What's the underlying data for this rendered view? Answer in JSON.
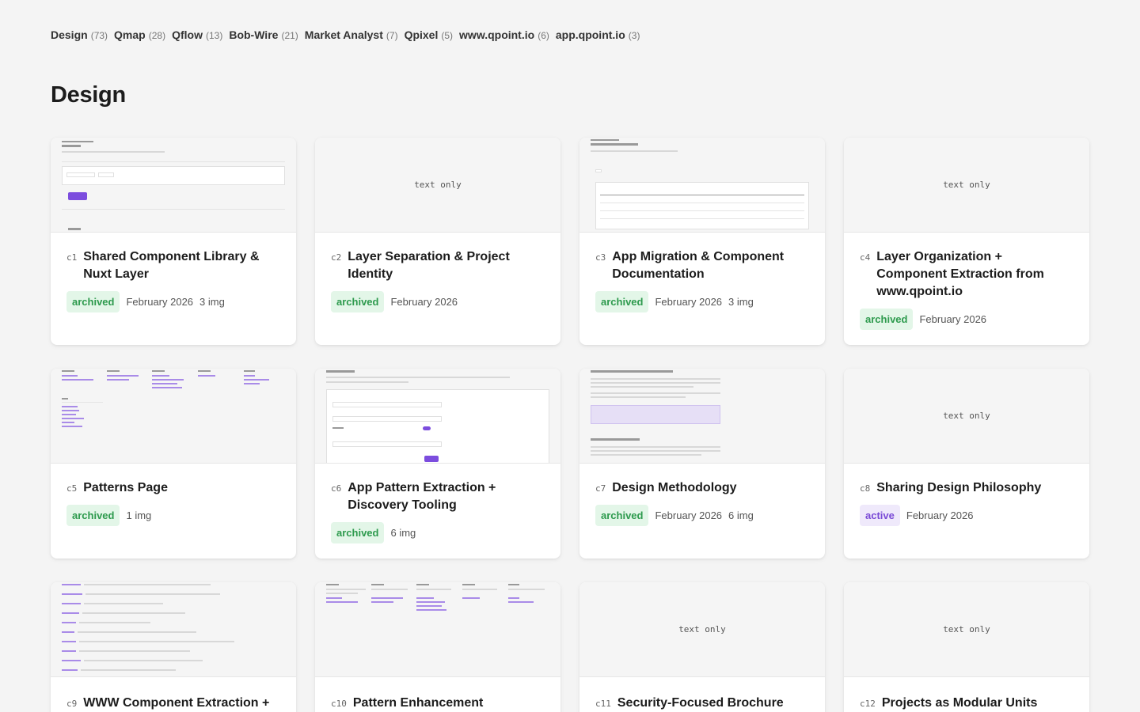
{
  "nav": [
    {
      "label": "Design",
      "count": "73"
    },
    {
      "label": "Qmap",
      "count": "28"
    },
    {
      "label": "Qflow",
      "count": "13"
    },
    {
      "label": "Bob-Wire",
      "count": "21"
    },
    {
      "label": "Market Analyst",
      "count": "7"
    },
    {
      "label": "Qpixel",
      "count": "5"
    },
    {
      "label": "www.qpoint.io",
      "count": "6"
    },
    {
      "label": "app.qpoint.io",
      "count": "3"
    }
  ],
  "page_title": "Design",
  "text_only_label": "text only",
  "cards": [
    {
      "id": "c1",
      "title": "Shared Component Library & Nuxt Layer",
      "status": "archived",
      "date": "February 2026",
      "images": "3 img"
    },
    {
      "id": "c2",
      "title": "Layer Separation & Project Identity",
      "status": "archived",
      "date": "February 2026",
      "images": ""
    },
    {
      "id": "c3",
      "title": "App Migration & Component Documentation",
      "status": "archived",
      "date": "February 2026",
      "images": "3 img"
    },
    {
      "id": "c4",
      "title": "Layer Organization + Component Extraction from www.qpoint.io",
      "status": "archived",
      "date": "February 2026",
      "images": ""
    },
    {
      "id": "c5",
      "title": "Patterns Page",
      "status": "archived",
      "date": "",
      "images": "1 img"
    },
    {
      "id": "c6",
      "title": "App Pattern Extraction + Discovery Tooling",
      "status": "archived",
      "date": "",
      "images": "6 img"
    },
    {
      "id": "c7",
      "title": "Design Methodology",
      "status": "archived",
      "date": "February 2026",
      "images": "6 img"
    },
    {
      "id": "c8",
      "title": "Sharing Design Philosophy",
      "status": "active",
      "date": "February 2026",
      "images": ""
    },
    {
      "id": "c9",
      "title": "WWW Component Extraction +",
      "status": "",
      "date": "",
      "images": ""
    },
    {
      "id": "c10",
      "title": "Pattern Enhancement",
      "status": "",
      "date": "",
      "images": ""
    },
    {
      "id": "c11",
      "title": "Security-Focused Brochure",
      "status": "",
      "date": "",
      "images": ""
    },
    {
      "id": "c12",
      "title": "Projects as Modular Units",
      "status": "",
      "date": "",
      "images": ""
    }
  ],
  "colors": {
    "archived_bg": "#e3f6e8",
    "archived_fg": "#2d9a4d",
    "active_bg": "#efe9fb",
    "active_fg": "#7a4ad6",
    "accent": "#7c4dde"
  }
}
